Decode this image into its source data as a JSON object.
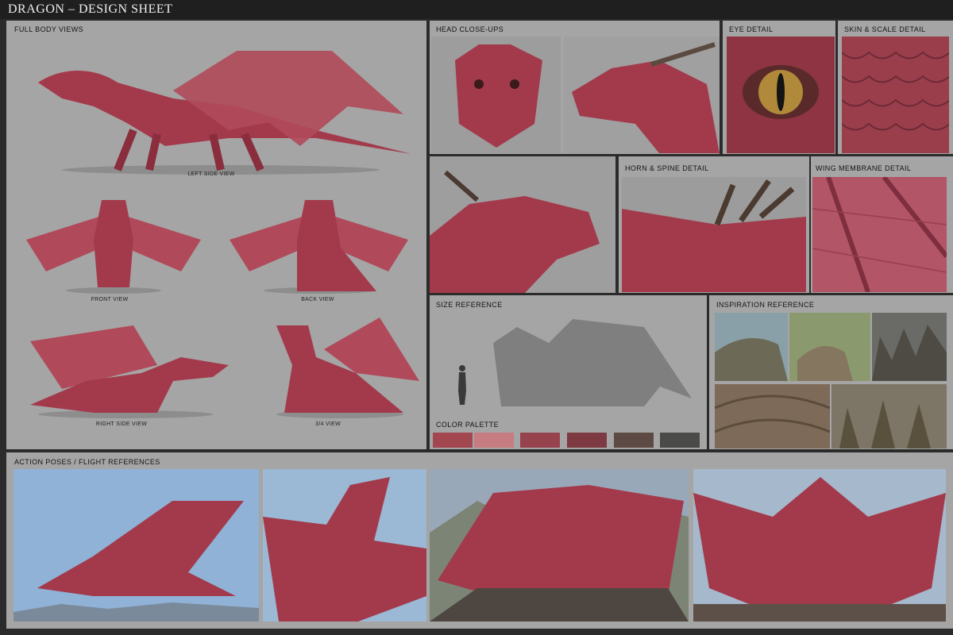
{
  "title": "DRAGON – DESIGN SHEET",
  "sections": {
    "full_body": "FULL BODY VIEWS",
    "head": "HEAD CLOSE-UPS",
    "eye": "EYE DETAIL",
    "skin": "SKIN & SCALE DETAIL",
    "horn": "HORN & SPINE DETAIL",
    "wing": "WING MEMBRANE DETAIL",
    "size": "SIZE REFERENCE",
    "palette": "COLOR PALETTE",
    "inspiration": "INSPIRATION REFERENCE",
    "action": "ACTION POSES / FLIGHT REFERENCES"
  },
  "captions": {
    "left": "LEFT SIDE VIEW",
    "front": "FRONT VIEW",
    "back": "BACK VIEW",
    "right": "RIGHT SIDE VIEW",
    "three_quarter": "3/4 VIEW"
  },
  "palette": [
    "#a2474f",
    "#c77c82",
    "#96434e",
    "#7e3a42",
    "#5e4a45",
    "#4a4a48"
  ],
  "colors": {
    "background": "#2b2b2b",
    "panel": "#a5a5a5",
    "dragon": "#a33a4c",
    "sky": "#8fb2d6"
  }
}
